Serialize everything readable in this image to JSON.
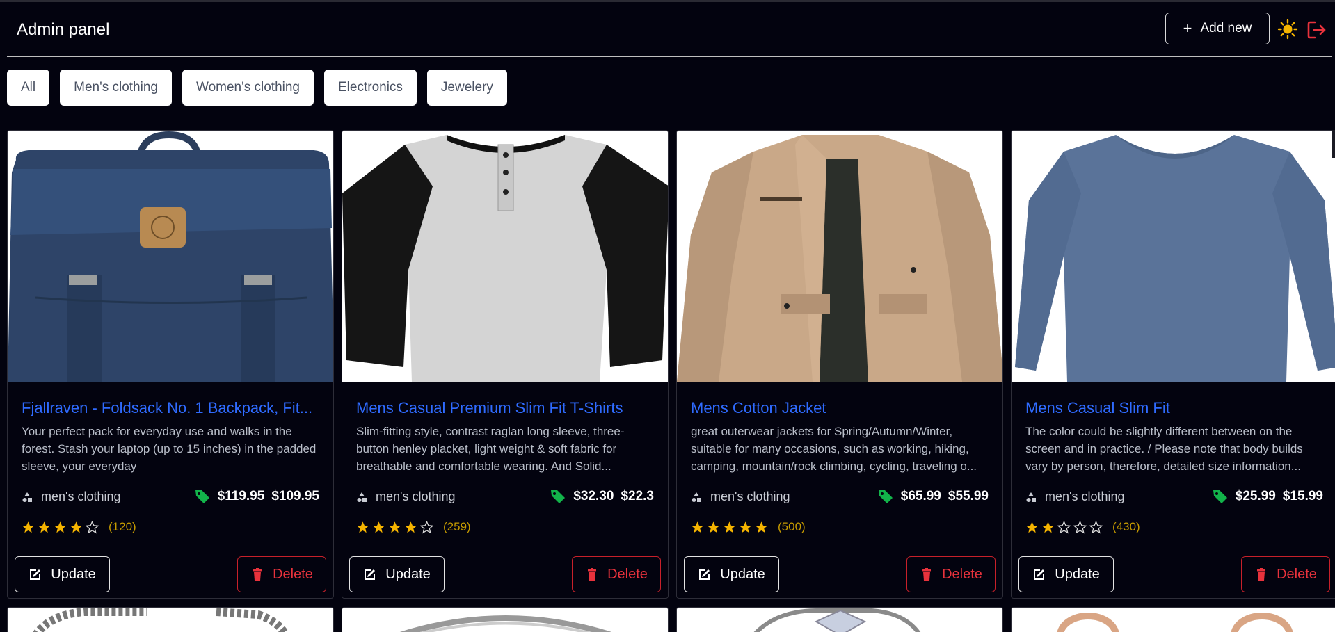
{
  "header": {
    "title": "Admin panel",
    "add_label": "Add new"
  },
  "filters": [
    "All",
    "Men's clothing",
    "Women's clothing",
    "Electronics",
    "Jewelery"
  ],
  "colors": {
    "background": "#03030f",
    "title_link": "#2f6bff",
    "star": "#f5b400",
    "tag": "#12b34a",
    "delete": "#e8323c"
  },
  "products": [
    {
      "title": "Fjallraven - Foldsack No. 1 Backpack, Fit...",
      "description": "Your perfect pack for everyday use and walks in the forest. Stash your laptop (up to 15 inches) in the padded sleeve, your everyday",
      "category": "men's clothing",
      "old_price": "$119.95",
      "price": "$109.95",
      "rating": 4,
      "count": "(120)",
      "update_label": "Update",
      "delete_label": "Delete"
    },
    {
      "title": "Mens Casual Premium Slim Fit T-Shirts",
      "description": "Slim-fitting style, contrast raglan long sleeve, three-button henley placket, light weight & soft fabric for breathable and comfortable wearing. And Solid...",
      "category": "men's clothing",
      "old_price": "$32.30",
      "price": "$22.3",
      "rating": 4,
      "count": "(259)",
      "update_label": "Update",
      "delete_label": "Delete"
    },
    {
      "title": "Mens Cotton Jacket",
      "description": "great outerwear jackets for Spring/Autumn/Winter, suitable for many occasions, such as working, hiking, camping, mountain/rock climbing, cycling, traveling o...",
      "category": "men's clothing",
      "old_price": "$65.99",
      "price": "$55.99",
      "rating": 5,
      "count": "(500)",
      "update_label": "Update",
      "delete_label": "Delete"
    },
    {
      "title": "Mens Casual Slim Fit",
      "description": "The color could be slightly different between on the screen and in practice. / Please note that body builds vary by person, therefore, detailed size information...",
      "category": "men's clothing",
      "old_price": "$25.99",
      "price": "$15.99",
      "rating": 2,
      "count": "(430)",
      "update_label": "Update",
      "delete_label": "Delete"
    }
  ]
}
